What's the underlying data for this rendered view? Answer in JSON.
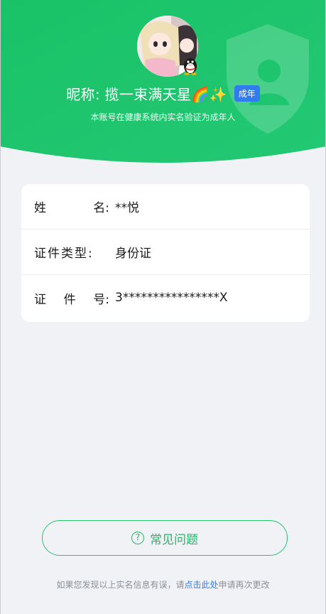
{
  "header": {
    "nickname_prefix": "昵称: ",
    "nickname": "揽一束满天星",
    "nickname_emojis": "🌈✨",
    "adult_badge": "成年",
    "verify_text": "本账号在健康系统内实名验证为成年人"
  },
  "info": {
    "name_label_chars": [
      "姓",
      "名"
    ],
    "name_value": "**悦",
    "id_type_label": "证件类型:",
    "id_type_value": "身份证",
    "id_number_label_chars": [
      "证",
      "件",
      "号"
    ],
    "id_number_value": "3****************X"
  },
  "faq": {
    "icon_glyph": "?",
    "label": "常见问题"
  },
  "footer": {
    "text_before": "如果您发现以上实名信息有误，请",
    "link_text": "点击此处",
    "text_after": "申请再次更改"
  },
  "colors": {
    "brand_green": "#1ec46c",
    "link_blue": "#2f7bf0",
    "badge_blue": "#2f7bf0"
  },
  "icons": {
    "shield": "shield-icon",
    "qq": "qq-penguin-icon",
    "help": "question-circle-icon"
  }
}
